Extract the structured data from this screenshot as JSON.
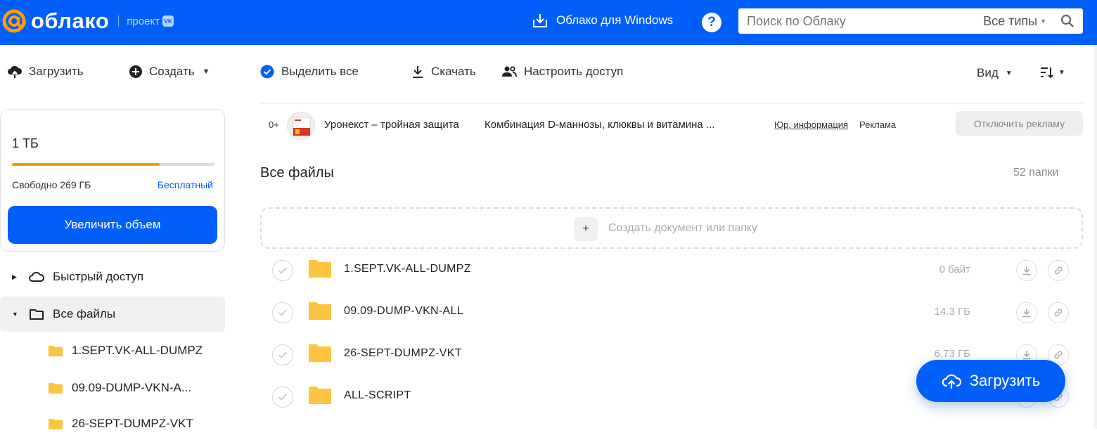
{
  "colors": {
    "brand": "#005ff9",
    "storage_fill": "#f29f05",
    "folder": "#fcc441"
  },
  "header": {
    "logo_text": "облако",
    "logo_sub": "проект",
    "vk_badge": "VK",
    "windows_link": "Облако для Windows",
    "help_icon": "?",
    "search_placeholder": "Поиск по Облаку",
    "search_types": "Все типы"
  },
  "left_toolbar": {
    "upload": "Загрузить",
    "create": "Создать"
  },
  "storage": {
    "total": "1 ТБ",
    "free": "Свободно 269 ГБ",
    "plan": "Бесплатный",
    "used_fraction": 0.73,
    "upgrade_button": "Увеличить объем"
  },
  "tree": {
    "quick_access": "Быстрый доступ",
    "all_files": "Все файлы",
    "subfolders": [
      "1.SEPT.VK-ALL-DUMPZ",
      "09.09-DUMP-VKN-A...",
      "26-SEPT-DUMPZ-VKT"
    ]
  },
  "main_toolbar": {
    "select_all": "Выделить все",
    "download": "Скачать",
    "access": "Настроить доступ",
    "view": "Вид"
  },
  "ad": {
    "age": "0+",
    "title": "Уронекст – тройная защита",
    "description": "Комбинация D-маннозы, клюквы и витамина ...",
    "legal": "Юр. информация",
    "label": "Реклама",
    "disable_button": "Отключить рекламу"
  },
  "files": {
    "title": "Все файлы",
    "count": "52 папки",
    "create_text": "Создать документ или папку",
    "rows": [
      {
        "name": "1.SEPT.VK-ALL-DUMPZ",
        "size": "0 байт"
      },
      {
        "name": "09.09-DUMP-VKN-ALL",
        "size": "14.3 ГБ"
      },
      {
        "name": "26-SEPT-DUMPZ-VKT",
        "size": "6.73 ГБ"
      },
      {
        "name": "ALL-SCRIPT",
        "size": ""
      }
    ]
  },
  "fab": {
    "label": "Загрузить"
  }
}
